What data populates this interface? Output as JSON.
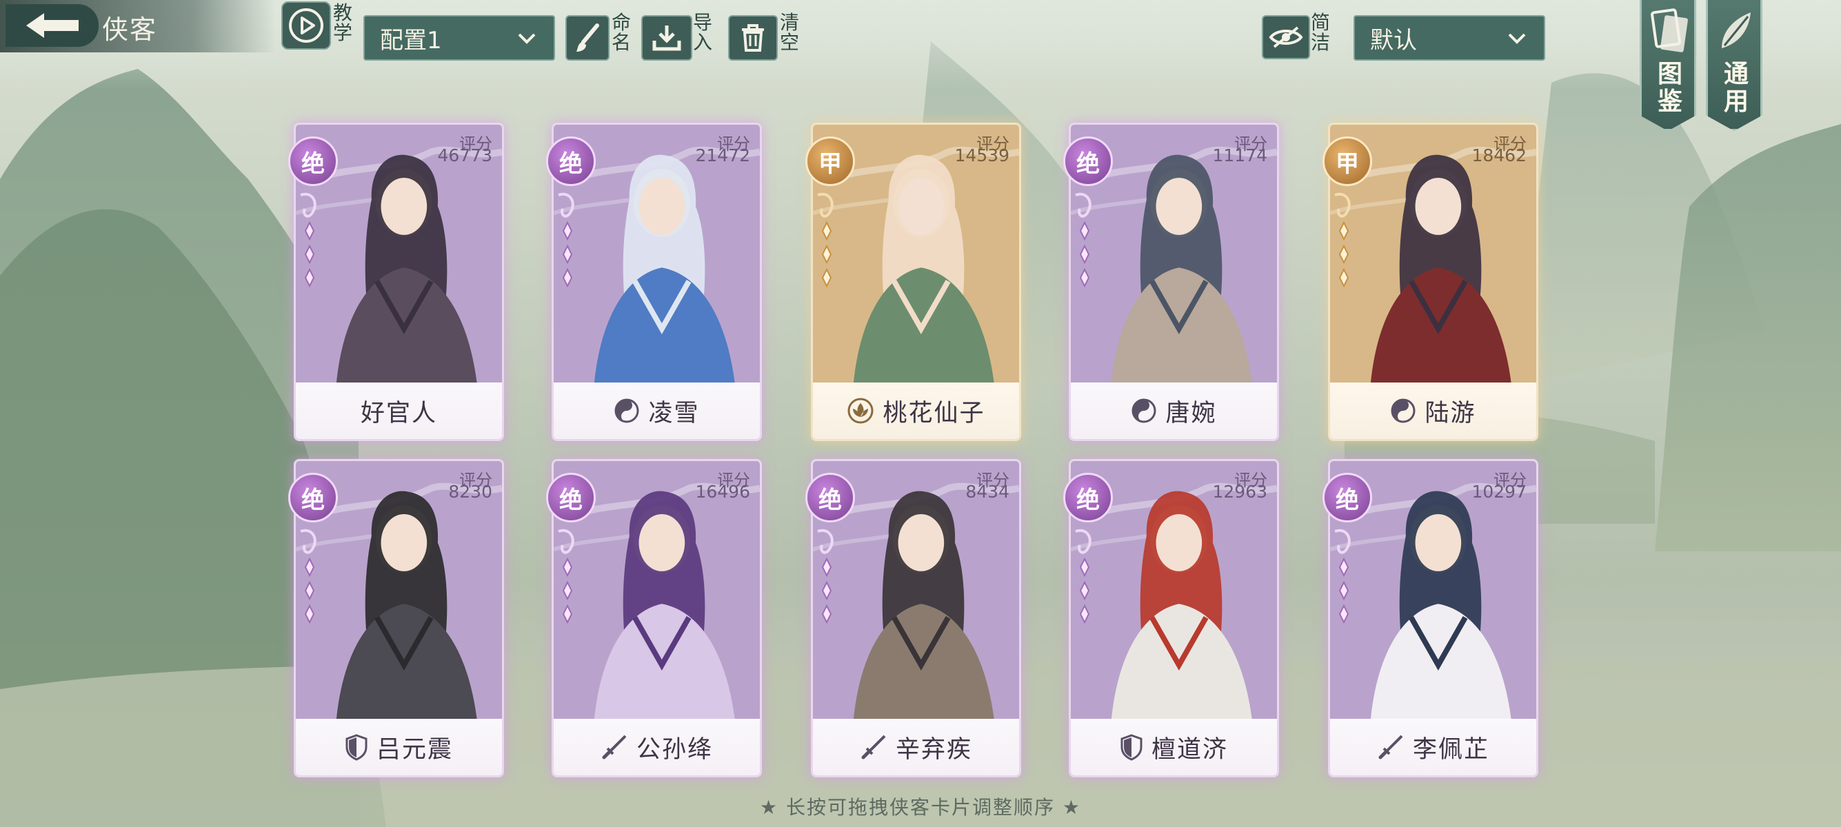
{
  "header": {
    "title": "侠客",
    "tutorial_label": "教学",
    "config_select": "配置1",
    "rename_label": "命名",
    "import_label": "导入",
    "clear_label": "清空",
    "simple_label": "简洁",
    "sort_select": "默认",
    "codex_label": "图鉴",
    "general_label": "通用"
  },
  "score_label": "评分",
  "cards": [
    {
      "name": "好官人",
      "score": "46773",
      "rank": "绝",
      "tier": "purple",
      "faction_icon": "none-icon"
    },
    {
      "name": "凌雪",
      "score": "21472",
      "rank": "绝",
      "tier": "purple",
      "faction_icon": "yinyang-icon"
    },
    {
      "name": "桃花仙子",
      "score": "14539",
      "rank": "甲",
      "tier": "gold",
      "faction_icon": "lotus-icon"
    },
    {
      "name": "唐婉",
      "score": "11174",
      "rank": "绝",
      "tier": "purple",
      "faction_icon": "yinyang-icon"
    },
    {
      "name": "陆游",
      "score": "18462",
      "rank": "甲",
      "tier": "gold",
      "faction_icon": "yinyang-icon"
    },
    {
      "name": "吕元震",
      "score": "8230",
      "rank": "绝",
      "tier": "purple",
      "faction_icon": "shield-icon"
    },
    {
      "name": "公孙绛",
      "score": "16496",
      "rank": "绝",
      "tier": "purple",
      "faction_icon": "sword-icon"
    },
    {
      "name": "辛弃疾",
      "score": "8434",
      "rank": "绝",
      "tier": "purple",
      "faction_icon": "sword-icon"
    },
    {
      "name": "檀道济",
      "score": "12963",
      "rank": "绝",
      "tier": "purple",
      "faction_icon": "shield-icon"
    },
    {
      "name": "李佩芷",
      "score": "10297",
      "rank": "绝",
      "tier": "purple",
      "faction_icon": "sword-icon"
    }
  ],
  "footer": {
    "hint": "★ 长按可拖拽侠客卡片调整顺序 ★"
  },
  "colors": {
    "panel": "#456a61",
    "purple_rank": "#7a4193",
    "gold_rank": "#a2692b"
  }
}
